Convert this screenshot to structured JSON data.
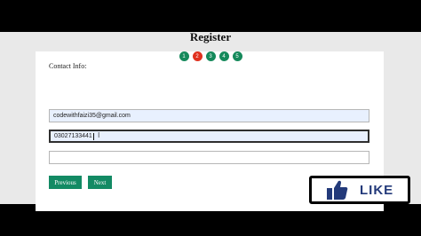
{
  "form": {
    "title": "Register",
    "steps": [
      "1",
      "2",
      "3",
      "4",
      "5"
    ],
    "active_step": "2",
    "section_label": "Contact Info:",
    "email_value": "codewithfaizi35@gmail.com",
    "phone_value": "03027133441",
    "third_value": "",
    "previous_label": "Previous",
    "next_label": "Next"
  },
  "overlay": {
    "like_label": "LIKE",
    "like_icon": "thumbs-up-icon"
  },
  "colors": {
    "step_color": "#15895b",
    "active_step_color": "#e0311f",
    "button_color": "#138a64",
    "like_text_color": "#233a7a"
  }
}
